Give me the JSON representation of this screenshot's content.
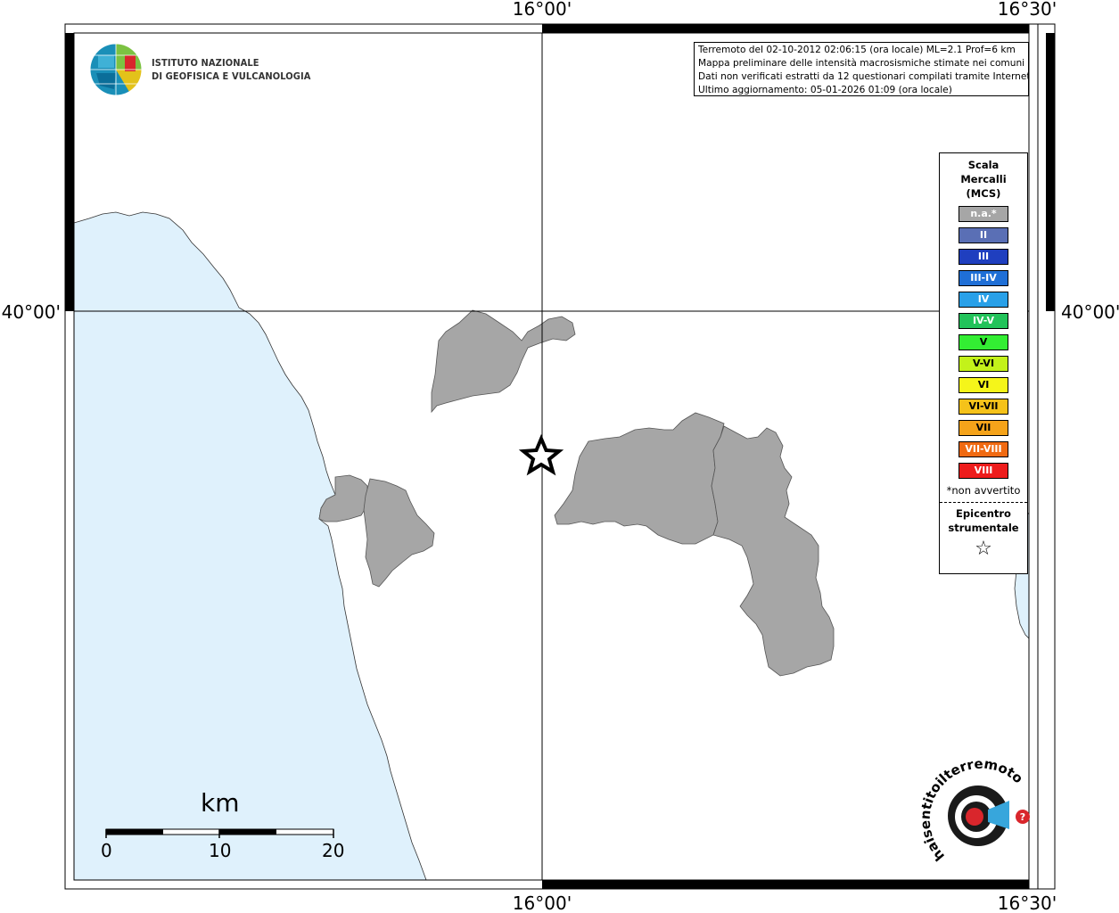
{
  "coords": {
    "top_mid": "16°00'",
    "top_right": "16°30'",
    "bottom_mid": "16°00'",
    "bottom_right": "16°30'",
    "left_lat": "40°00'",
    "right_lat": "40°00'"
  },
  "logo": {
    "line1": "ISTITUTO NAZIONALE",
    "line2": "DI GEOFISICA E VULCANOLOGIA"
  },
  "info": {
    "line1": "Terremoto del 02-10-2012 02:06:15 (ora locale) ML=2.1 Prof=6 km",
    "line2": "Mappa preliminare delle intensità macrosismiche stimate nei comuni",
    "line3": "Dati non verificati estratti da 12 questionari compilati tramite Internet.",
    "line4": "Ultimo aggiornamento: 05-01-2026 01:09 (ora locale)"
  },
  "legend": {
    "title1": "Scala",
    "title2": "Mercalli",
    "title3": "(MCS)",
    "classes": [
      {
        "label": "n.a.*",
        "color": "#a6a6a6"
      },
      {
        "label": "II",
        "color": "#5a6fb5"
      },
      {
        "label": "III",
        "color": "#1f3fbf"
      },
      {
        "label": "III-IV",
        "color": "#1f6fd6"
      },
      {
        "label": "IV",
        "color": "#29a0e8"
      },
      {
        "label": "IV-V",
        "color": "#22c35a"
      },
      {
        "label": "V",
        "color": "#33ee33"
      },
      {
        "label": "V-VI",
        "color": "#c3f21a"
      },
      {
        "label": "VI",
        "color": "#f5f51a"
      },
      {
        "label": "VI-VII",
        "color": "#f5c21a"
      },
      {
        "label": "VII",
        "color": "#f5a31a"
      },
      {
        "label": "VII-VIII",
        "color": "#f06a12"
      },
      {
        "label": "VIII",
        "color": "#ee1c1c"
      }
    ],
    "note": "*non avvertito",
    "epi1": "Epicentro",
    "epi2": "strumentale",
    "star": "☆"
  },
  "scale": {
    "unit": "km",
    "l0": "0",
    "l10": "10",
    "l20": "20"
  },
  "watermark": {
    "text": "haisentitoilterremoto.it"
  },
  "colors": {
    "sea": "#dff1fc",
    "municipality": "#a6a6a6"
  }
}
